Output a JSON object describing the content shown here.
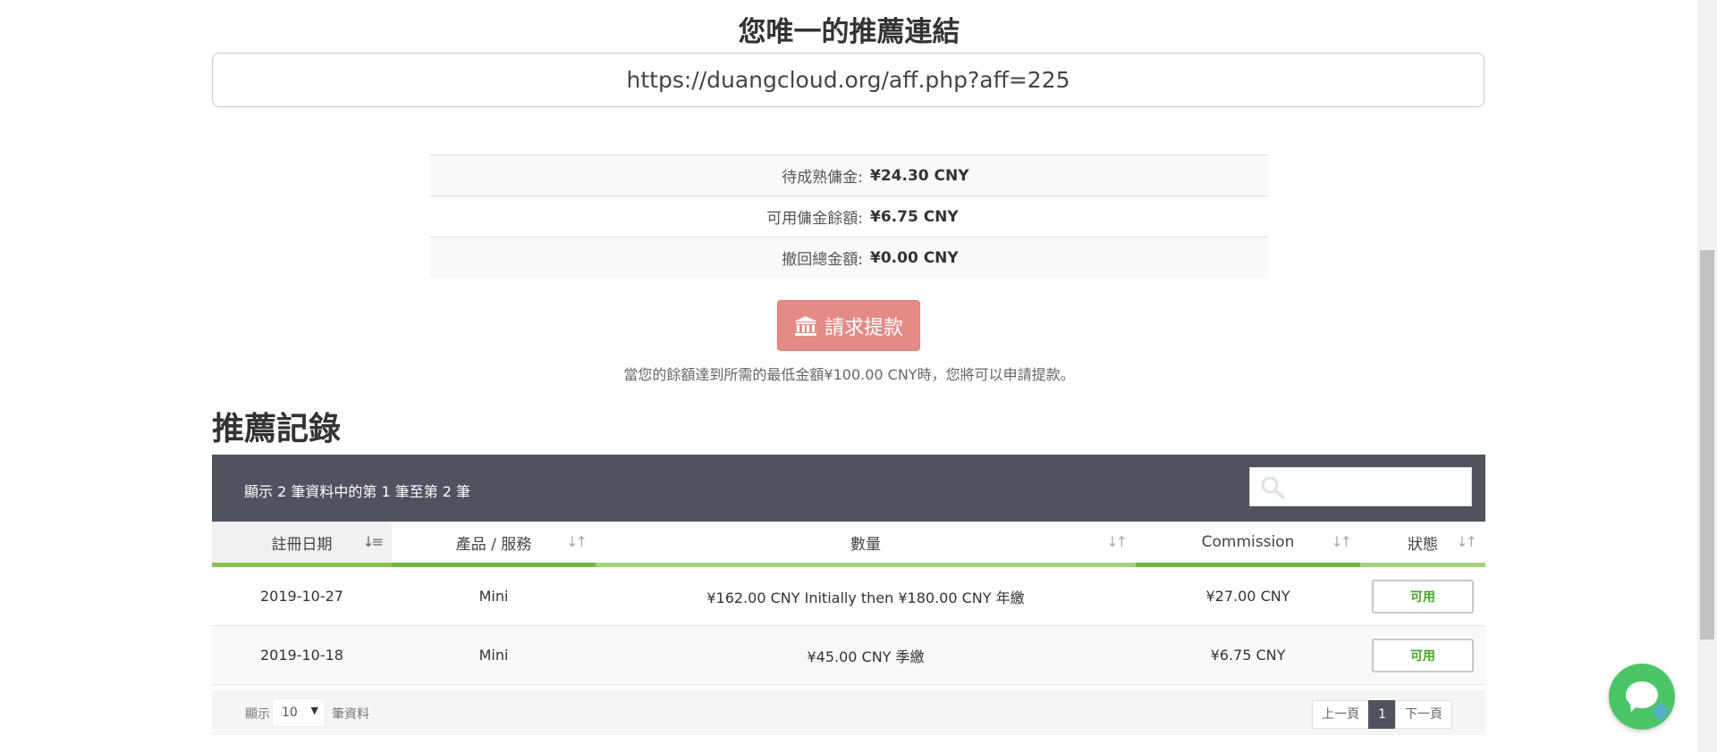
{
  "referral": {
    "title": "您唯一的推薦連結",
    "link": "https://duangcloud.org/aff.php?aff=225"
  },
  "stats": [
    {
      "label": "待成熟傭金:",
      "value": "¥24.30 CNY"
    },
    {
      "label": "可用傭金餘額:",
      "value": "¥6.75 CNY"
    },
    {
      "label": "撤回總金額:",
      "value": "¥0.00 CNY"
    }
  ],
  "withdraw_button": "請求提款",
  "notice": "當您的餘額達到所需的最低金額¥100.00 CNY時，您將可以申請提款。",
  "records_title": "推薦記錄",
  "table": {
    "info": "顯示 2 筆資料中的第 1 筆至第 2 筆",
    "search_placeholder": "",
    "columns": [
      "註冊日期",
      "產品 / 服務",
      "數量",
      "Commission",
      "狀態"
    ],
    "rows": [
      {
        "date": "2019-10-27",
        "product": "Mini",
        "amount": "¥162.00 CNY Initially then ¥180.00 CNY 年繳",
        "commission": "¥27.00 CNY",
        "status": "可用"
      },
      {
        "date": "2019-10-18",
        "product": "Mini",
        "amount": "¥45.00 CNY 季繳",
        "commission": "¥6.75 CNY",
        "status": "可用"
      }
    ],
    "length_prefix": "顯示",
    "length_value": "10",
    "length_suffix": "筆資料",
    "pager": {
      "prev": "上一頁",
      "current": "1",
      "next": "下一頁"
    }
  },
  "colors": {
    "header_bar": "#50535e",
    "withdraw_button": "#e48b87",
    "status_text": "#48a32c",
    "chat": "#4cc569"
  },
  "icons": [
    "bank-icon",
    "search-icon",
    "sort-icon",
    "chat-icon"
  ]
}
